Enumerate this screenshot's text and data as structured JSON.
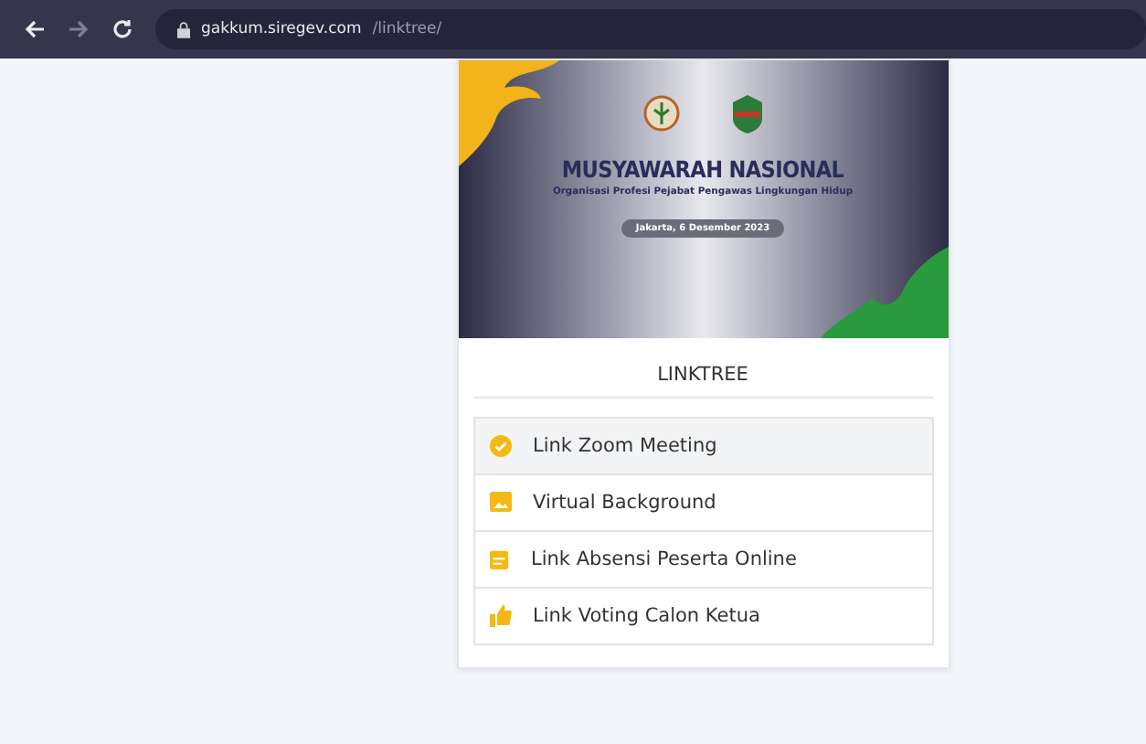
{
  "browser": {
    "url_host": "gakkum.siregev.com",
    "url_path": "/linktree/"
  },
  "banner": {
    "title": "MUSYAWARAH NASIONAL",
    "subtitle": "Organisasi Profesi Pejabat Pengawas Lingkungan Hidup",
    "date": "Jakarta, 6 Desember 2023"
  },
  "heading": "LINKTREE",
  "links": [
    {
      "label": "Link Zoom Meeting",
      "kind": "check",
      "selected": true
    },
    {
      "label": "Virtual Background",
      "kind": "image",
      "selected": false
    },
    {
      "label": "Link Absensi Peserta Online",
      "kind": "calendar",
      "selected": false
    },
    {
      "label": "Link Voting Calon Ketua",
      "kind": "thumb",
      "selected": false
    }
  ]
}
